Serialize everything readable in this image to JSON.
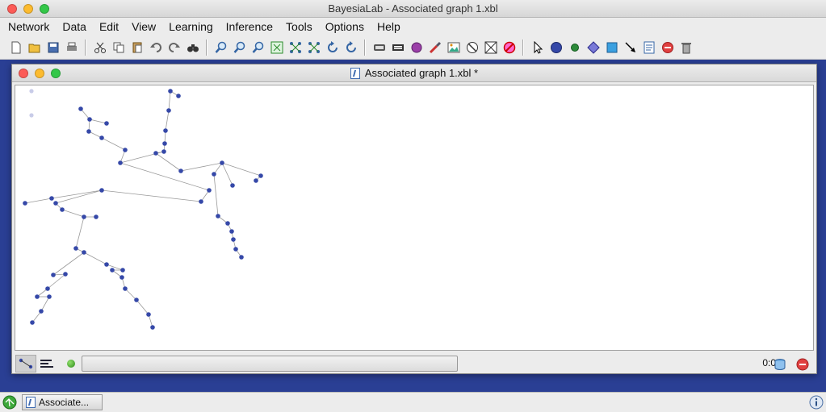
{
  "window": {
    "title": "BayesiaLab - Associated graph 1.xbl"
  },
  "menu": [
    "Network",
    "Data",
    "Edit",
    "View",
    "Learning",
    "Inference",
    "Tools",
    "Options",
    "Help"
  ],
  "toolbar": {
    "groups": [
      [
        "new-icon",
        "open-icon",
        "save-icon",
        "print-icon"
      ],
      [
        "cut-icon",
        "copy-icon",
        "paste-icon",
        "undo-icon",
        "redo-icon",
        "find-icon"
      ],
      [
        "zoom-in-icon",
        "zoom-out-icon",
        "zoom-fit-icon",
        "fit-window-icon",
        "layout-icon",
        "distribute-icon",
        "rotate-left-icon",
        "rotate-right-icon"
      ],
      [
        "arc-style-icon",
        "node-style-icon",
        "node-color-icon",
        "brush-icon",
        "image-icon",
        "no-display-icon",
        "hide-icon",
        "forbid-icon"
      ],
      [
        "pointer-icon",
        "node-icon",
        "small-node-icon",
        "decision-node-icon",
        "utility-node-icon",
        "arc-icon",
        "note-icon",
        "delete-icon",
        "trash-icon"
      ]
    ]
  },
  "document": {
    "title": "Associated graph 1.xbl *"
  },
  "status": {
    "coords": "0:0"
  },
  "taskbar": {
    "item_label": "Associate..."
  },
  "colors": {
    "node": "#3548a8",
    "desktop": "#2a3f94",
    "edge": "#999999"
  }
}
